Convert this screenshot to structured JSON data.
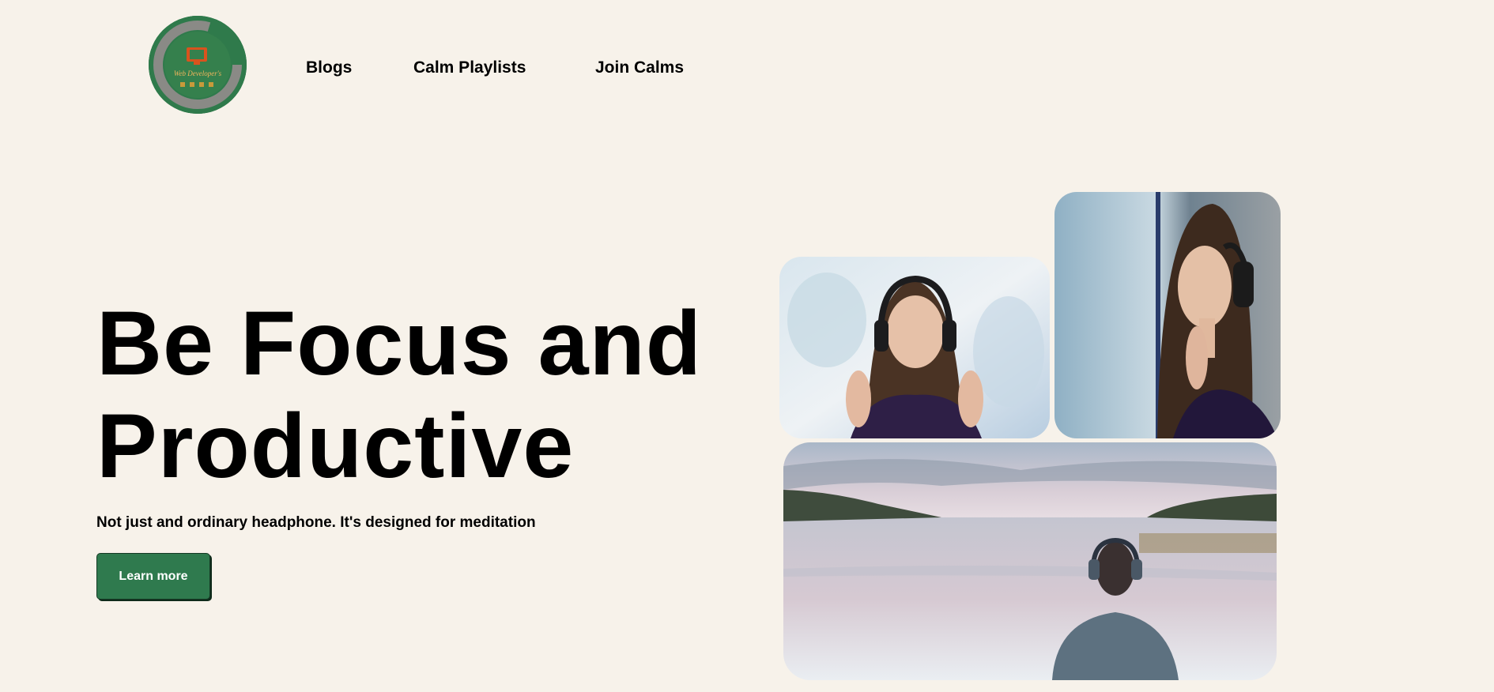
{
  "logo": {
    "text": "Web Developer's",
    "alt": "Web Developer's logo"
  },
  "nav": {
    "items": [
      {
        "label": "Blogs"
      },
      {
        "label": "Calm Playlists"
      },
      {
        "label": "Join Calms"
      }
    ]
  },
  "hero": {
    "title": "Be Focus and Productive",
    "subtitle": "Not just and ordinary headphone. It's designed for meditation",
    "cta_label": "Learn more"
  },
  "gallery": {
    "photos": [
      {
        "description": "woman with headphones, eyes closed, frosted window"
      },
      {
        "description": "woman with headphones by rainy window"
      },
      {
        "description": "person with headphones facing a calm lake"
      }
    ]
  },
  "colors": {
    "background": "#f7f2ea",
    "accent": "#2f7a4e",
    "logo_ring": "#8a8a86",
    "logo_orange": "#d9531e"
  }
}
